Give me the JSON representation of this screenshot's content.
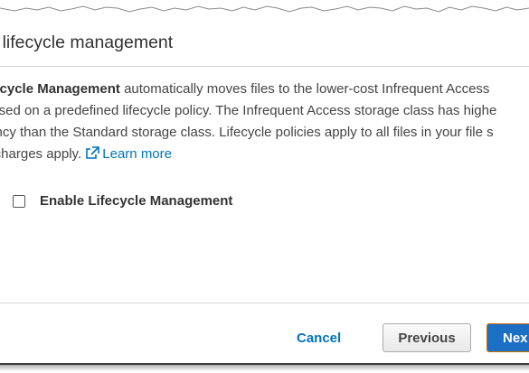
{
  "dialog": {
    "title": "le lifecycle management",
    "description": {
      "line1_bold": "ifecycle Management",
      "line1_rest": " automatically moves files to the lower-cost Infrequent Access",
      "line2": "based on a predefined lifecycle policy. The Infrequent Access storage class has highe",
      "line3": "tency than the Standard storage class. Lifecycle policies apply to all files in your file s",
      "line4": "s charges apply. ",
      "learn_more_label": "Learn more",
      "learn_more_icon": "external-link-icon"
    },
    "checkbox": {
      "label": "Enable Lifecycle Management",
      "checked": false
    },
    "footer": {
      "cancel_label": "Cancel",
      "previous_label": "Previous",
      "next_label": "Nex"
    }
  },
  "colors": {
    "link": "#0073bb",
    "primary_button": "#1b6fc4",
    "primary_button_border": "#cc6f00",
    "text": "#444444"
  }
}
